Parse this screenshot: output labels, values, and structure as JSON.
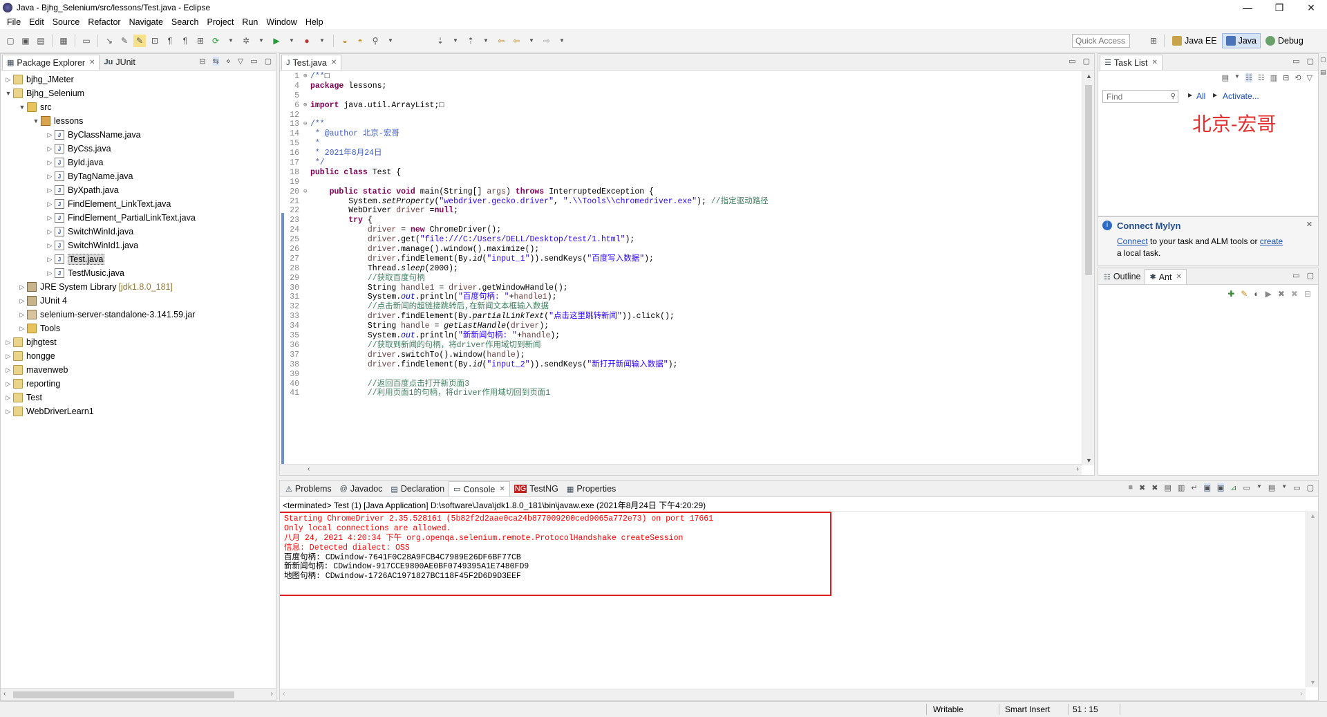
{
  "window": {
    "title": "Java - Bjhg_Selenium/src/lessons/Test.java - Eclipse",
    "minimize": "—",
    "restore": "❐",
    "close": "✕"
  },
  "menu": [
    "File",
    "Edit",
    "Source",
    "Refactor",
    "Navigate",
    "Search",
    "Project",
    "Run",
    "Window",
    "Help"
  ],
  "toolbar": {
    "quick_access_placeholder": "Quick Access"
  },
  "perspectives": [
    {
      "label": "Java EE",
      "active": false
    },
    {
      "label": "Java",
      "active": true
    },
    {
      "label": "Debug",
      "active": false
    }
  ],
  "package_explorer": {
    "tabs": [
      "Package Explorer",
      "JUnit"
    ],
    "tree": [
      {
        "label": "bjhg_JMeter",
        "depth": 0,
        "expanded": false,
        "icon": "proj"
      },
      {
        "label": "Bjhg_Selenium",
        "depth": 0,
        "expanded": true,
        "icon": "proj"
      },
      {
        "label": "src",
        "depth": 1,
        "expanded": true,
        "icon": "folder"
      },
      {
        "label": "lessons",
        "depth": 2,
        "expanded": true,
        "icon": "pkg"
      },
      {
        "label": "ByClassName.java",
        "depth": 3,
        "expanded": false,
        "icon": "jfile"
      },
      {
        "label": "ByCss.java",
        "depth": 3,
        "expanded": false,
        "icon": "jfile"
      },
      {
        "label": "ById.java",
        "depth": 3,
        "expanded": false,
        "icon": "jfile"
      },
      {
        "label": "ByTagName.java",
        "depth": 3,
        "expanded": false,
        "icon": "jfile"
      },
      {
        "label": "ByXpath.java",
        "depth": 3,
        "expanded": false,
        "icon": "jfile"
      },
      {
        "label": "FindElement_LinkText.java",
        "depth": 3,
        "expanded": false,
        "icon": "jfile"
      },
      {
        "label": "FindElement_PartialLinkText.java",
        "depth": 3,
        "expanded": false,
        "icon": "jfile"
      },
      {
        "label": "SwitchWinId.java",
        "depth": 3,
        "expanded": false,
        "icon": "jfile"
      },
      {
        "label": "SwitchWinId1.java",
        "depth": 3,
        "expanded": false,
        "icon": "jfile"
      },
      {
        "label": "Test.java",
        "depth": 3,
        "expanded": false,
        "icon": "jfile",
        "selected": true
      },
      {
        "label": "TestMusic.java",
        "depth": 3,
        "expanded": false,
        "icon": "jfile"
      },
      {
        "label": "JRE System Library",
        "suffix": "[jdk1.8.0_181]",
        "depth": 1,
        "expanded": false,
        "icon": "lib"
      },
      {
        "label": "JUnit 4",
        "depth": 1,
        "expanded": false,
        "icon": "lib"
      },
      {
        "label": "selenium-server-standalone-3.141.59.jar",
        "depth": 1,
        "expanded": false,
        "icon": "jar"
      },
      {
        "label": "Tools",
        "depth": 1,
        "expanded": false,
        "icon": "folder"
      },
      {
        "label": "bjhgtest",
        "depth": 0,
        "expanded": false,
        "icon": "proj"
      },
      {
        "label": "hongge",
        "depth": 0,
        "expanded": false,
        "icon": "proj"
      },
      {
        "label": "mavenweb",
        "depth": 0,
        "expanded": false,
        "icon": "proj"
      },
      {
        "label": "reporting",
        "depth": 0,
        "expanded": false,
        "icon": "proj"
      },
      {
        "label": "Test",
        "depth": 0,
        "expanded": false,
        "icon": "proj"
      },
      {
        "label": "WebDriverLearn1",
        "depth": 0,
        "expanded": false,
        "icon": "proj"
      }
    ]
  },
  "editor": {
    "tab": "Test.java",
    "lines": [
      {
        "n": "1",
        "marker": "⊕",
        "parts": [
          [
            "jd",
            "/**"
          ],
          [
            "",
            "□"
          ]
        ]
      },
      {
        "n": "4",
        "parts": [
          [
            "kw",
            "package"
          ],
          [
            "",
            " lessons;"
          ]
        ]
      },
      {
        "n": "5",
        "parts": []
      },
      {
        "n": "6",
        "marker": "⊕",
        "parts": [
          [
            "kw",
            "import"
          ],
          [
            "",
            " java.util.ArrayList;□"
          ]
        ]
      },
      {
        "n": "12",
        "parts": []
      },
      {
        "n": "13",
        "marker": "⊖",
        "parts": [
          [
            "jd",
            "/**"
          ]
        ]
      },
      {
        "n": "14",
        "parts": [
          [
            "jd",
            " * @author 北京-宏哥"
          ]
        ]
      },
      {
        "n": "15",
        "parts": [
          [
            "jd",
            " *"
          ]
        ]
      },
      {
        "n": "16",
        "parts": [
          [
            "jd",
            " * 2021年8月24日"
          ]
        ]
      },
      {
        "n": "17",
        "parts": [
          [
            "jd",
            " */"
          ]
        ]
      },
      {
        "n": "18",
        "parts": [
          [
            "kw",
            "public class"
          ],
          [
            "",
            " Test {"
          ]
        ]
      },
      {
        "n": "19",
        "parts": []
      },
      {
        "n": "20",
        "marker": "⊖",
        "parts": [
          [
            "",
            "    "
          ],
          [
            "kw",
            "public static void"
          ],
          [
            "",
            " main(String[] "
          ],
          [
            "var",
            "args"
          ],
          [
            "",
            ") "
          ],
          [
            "kw",
            "throws"
          ],
          [
            "",
            " InterruptedException {"
          ]
        ]
      },
      {
        "n": "21",
        "parts": [
          [
            "",
            "        System."
          ],
          [
            "ital",
            "setProperty"
          ],
          [
            "",
            "("
          ],
          [
            "str",
            "\"webdriver.gecko.driver\""
          ],
          [
            "",
            ", "
          ],
          [
            "str",
            "\".\\\\Tools\\\\chromedriver.exe\""
          ],
          [
            "",
            "); "
          ],
          [
            "com",
            "//指定驱动路径"
          ]
        ]
      },
      {
        "n": "22",
        "parts": [
          [
            "",
            "        WebDriver "
          ],
          [
            "var",
            "driver"
          ],
          [
            "",
            " ="
          ],
          [
            "kw",
            "null"
          ],
          [
            "",
            ";"
          ]
        ]
      },
      {
        "n": "23",
        "parts": [
          [
            "",
            "        "
          ],
          [
            "kw",
            "try"
          ],
          [
            "",
            " {"
          ]
        ]
      },
      {
        "n": "24",
        "parts": [
          [
            "",
            "            "
          ],
          [
            "var",
            "driver"
          ],
          [
            "",
            " = "
          ],
          [
            "kw",
            "new"
          ],
          [
            "",
            " ChromeDriver();"
          ]
        ]
      },
      {
        "n": "25",
        "parts": [
          [
            "",
            "            "
          ],
          [
            "var",
            "driver"
          ],
          [
            "",
            ".get("
          ],
          [
            "str",
            "\"file:///C:/Users/DELL/Desktop/test/1.html\""
          ],
          [
            "",
            ");"
          ]
        ]
      },
      {
        "n": "26",
        "parts": [
          [
            "",
            "            "
          ],
          [
            "var",
            "driver"
          ],
          [
            "",
            ".manage().window().maximize();"
          ]
        ]
      },
      {
        "n": "27",
        "parts": [
          [
            "",
            "            "
          ],
          [
            "var",
            "driver"
          ],
          [
            "",
            ".findElement(By."
          ],
          [
            "ital",
            "id"
          ],
          [
            "",
            "("
          ],
          [
            "str",
            "\"input_1\""
          ],
          [
            "",
            ")).sendKeys("
          ],
          [
            "str",
            "\"百度写入数据\""
          ],
          [
            "",
            ");"
          ]
        ]
      },
      {
        "n": "28",
        "parts": [
          [
            "",
            "            Thread."
          ],
          [
            "ital",
            "sleep"
          ],
          [
            "",
            "(2000);"
          ]
        ]
      },
      {
        "n": "29",
        "parts": [
          [
            "",
            "            "
          ],
          [
            "com",
            "//获取百度句柄"
          ]
        ]
      },
      {
        "n": "30",
        "parts": [
          [
            "",
            "            String "
          ],
          [
            "var",
            "handle1"
          ],
          [
            "",
            " = "
          ],
          [
            "var",
            "driver"
          ],
          [
            "",
            ".getWindowHandle();"
          ]
        ]
      },
      {
        "n": "31",
        "parts": [
          [
            "",
            "            System."
          ],
          [
            "fld",
            "out"
          ],
          [
            "",
            ".println("
          ],
          [
            "str",
            "\"百度句柄: \""
          ],
          [
            "",
            "+"
          ],
          [
            "var",
            "handle1"
          ],
          [
            "",
            ");"
          ]
        ]
      },
      {
        "n": "32",
        "parts": [
          [
            "",
            "            "
          ],
          [
            "com",
            "//点击新闻的超链接跳转后,在新闻文本框输入数据"
          ]
        ]
      },
      {
        "n": "33",
        "parts": [
          [
            "",
            "            "
          ],
          [
            "var",
            "driver"
          ],
          [
            "",
            ".findElement(By."
          ],
          [
            "ital",
            "partialLinkText"
          ],
          [
            "",
            "("
          ],
          [
            "str",
            "\"点击这里跳转新闻\""
          ],
          [
            "",
            ")).click();"
          ]
        ]
      },
      {
        "n": "34",
        "parts": [
          [
            "",
            "            String "
          ],
          [
            "var",
            "handle"
          ],
          [
            "",
            " = "
          ],
          [
            "ital",
            "getLastHandle"
          ],
          [
            "",
            "("
          ],
          [
            "var",
            "driver"
          ],
          [
            "",
            ");"
          ]
        ]
      },
      {
        "n": "35",
        "parts": [
          [
            "",
            "            System."
          ],
          [
            "fld",
            "out"
          ],
          [
            "",
            ".println("
          ],
          [
            "str",
            "\"新新闻句柄: \""
          ],
          [
            "",
            "+"
          ],
          [
            "var",
            "handle"
          ],
          [
            "",
            ");"
          ]
        ]
      },
      {
        "n": "36",
        "parts": [
          [
            "",
            "            "
          ],
          [
            "com",
            "//获取到新闻的句柄，将driver作用域切到新闻"
          ]
        ]
      },
      {
        "n": "37",
        "parts": [
          [
            "",
            "            "
          ],
          [
            "var",
            "driver"
          ],
          [
            "",
            ".switchTo().window("
          ],
          [
            "var",
            "handle"
          ],
          [
            "",
            ");"
          ]
        ]
      },
      {
        "n": "38",
        "parts": [
          [
            "",
            "            "
          ],
          [
            "var",
            "driver"
          ],
          [
            "",
            ".findElement(By."
          ],
          [
            "ital",
            "id"
          ],
          [
            "",
            "("
          ],
          [
            "str",
            "\"input_2\""
          ],
          [
            "",
            ")).sendKeys("
          ],
          [
            "str",
            "\"新打开新闻输入数据\""
          ],
          [
            "",
            ");"
          ]
        ]
      },
      {
        "n": "39",
        "parts": []
      },
      {
        "n": "40",
        "parts": [
          [
            "",
            "            "
          ],
          [
            "com",
            "//返回百度点击打开新页面3"
          ]
        ]
      },
      {
        "n": "41",
        "parts": [
          [
            "",
            "            "
          ],
          [
            "com",
            "//利用页面1的句柄，将driver作用域切回到页面1"
          ]
        ]
      }
    ]
  },
  "task_list": {
    "tab": "Task List",
    "find_placeholder": "Find",
    "all_label": "All",
    "activate_label": "Activate...",
    "watermark": "北京-宏哥"
  },
  "mylyn": {
    "title": "Connect Mylyn",
    "link_connect": "Connect",
    "mid_text": " to your task and ALM tools or ",
    "link_create": "create",
    "end_text": "a local task."
  },
  "outline": {
    "tabs": [
      "Outline",
      "Ant"
    ]
  },
  "bottom": {
    "tabs": [
      "Problems",
      "Javadoc",
      "Declaration",
      "Console",
      "TestNG",
      "Properties"
    ],
    "active_tab": "Console",
    "terminated": "<terminated> Test (1) [Java Application] D:\\software\\Java\\jdk1.8.0_181\\bin\\javaw.exe (2021年8月24日 下午4:20:29)",
    "console_lines": [
      {
        "text": "Starting ChromeDriver 2.35.528161 (5b82f2d2aae0ca24b877009200ced9065a772e73) on port 17661",
        "err": true
      },
      {
        "text": "Only local connections are allowed.",
        "err": true
      },
      {
        "text": "八月 24, 2021 4:20:34 下午 org.openqa.selenium.remote.ProtocolHandshake createSession",
        "err": true
      },
      {
        "text": "信息: Detected dialect: OSS",
        "err": true
      },
      {
        "text": "百度句柄: CDwindow-7641F0C28A9FCB4C7989E26DF6BF77CB",
        "err": false
      },
      {
        "text": "新新闻句柄: CDwindow-917CCE9800AE0BF0749395A1E7480FD9",
        "err": false
      },
      {
        "text": "地图句柄: CDwindow-1726AC1971827BC118F45F2D6D9D3EEF",
        "err": false
      }
    ]
  },
  "status": {
    "writable": "Writable",
    "insert_mode": "Smart Insert",
    "position": "51 : 15"
  },
  "colors": {
    "highlight_box": "#e02020",
    "console_error": "#ff0000",
    "watermark": "#e03030"
  }
}
